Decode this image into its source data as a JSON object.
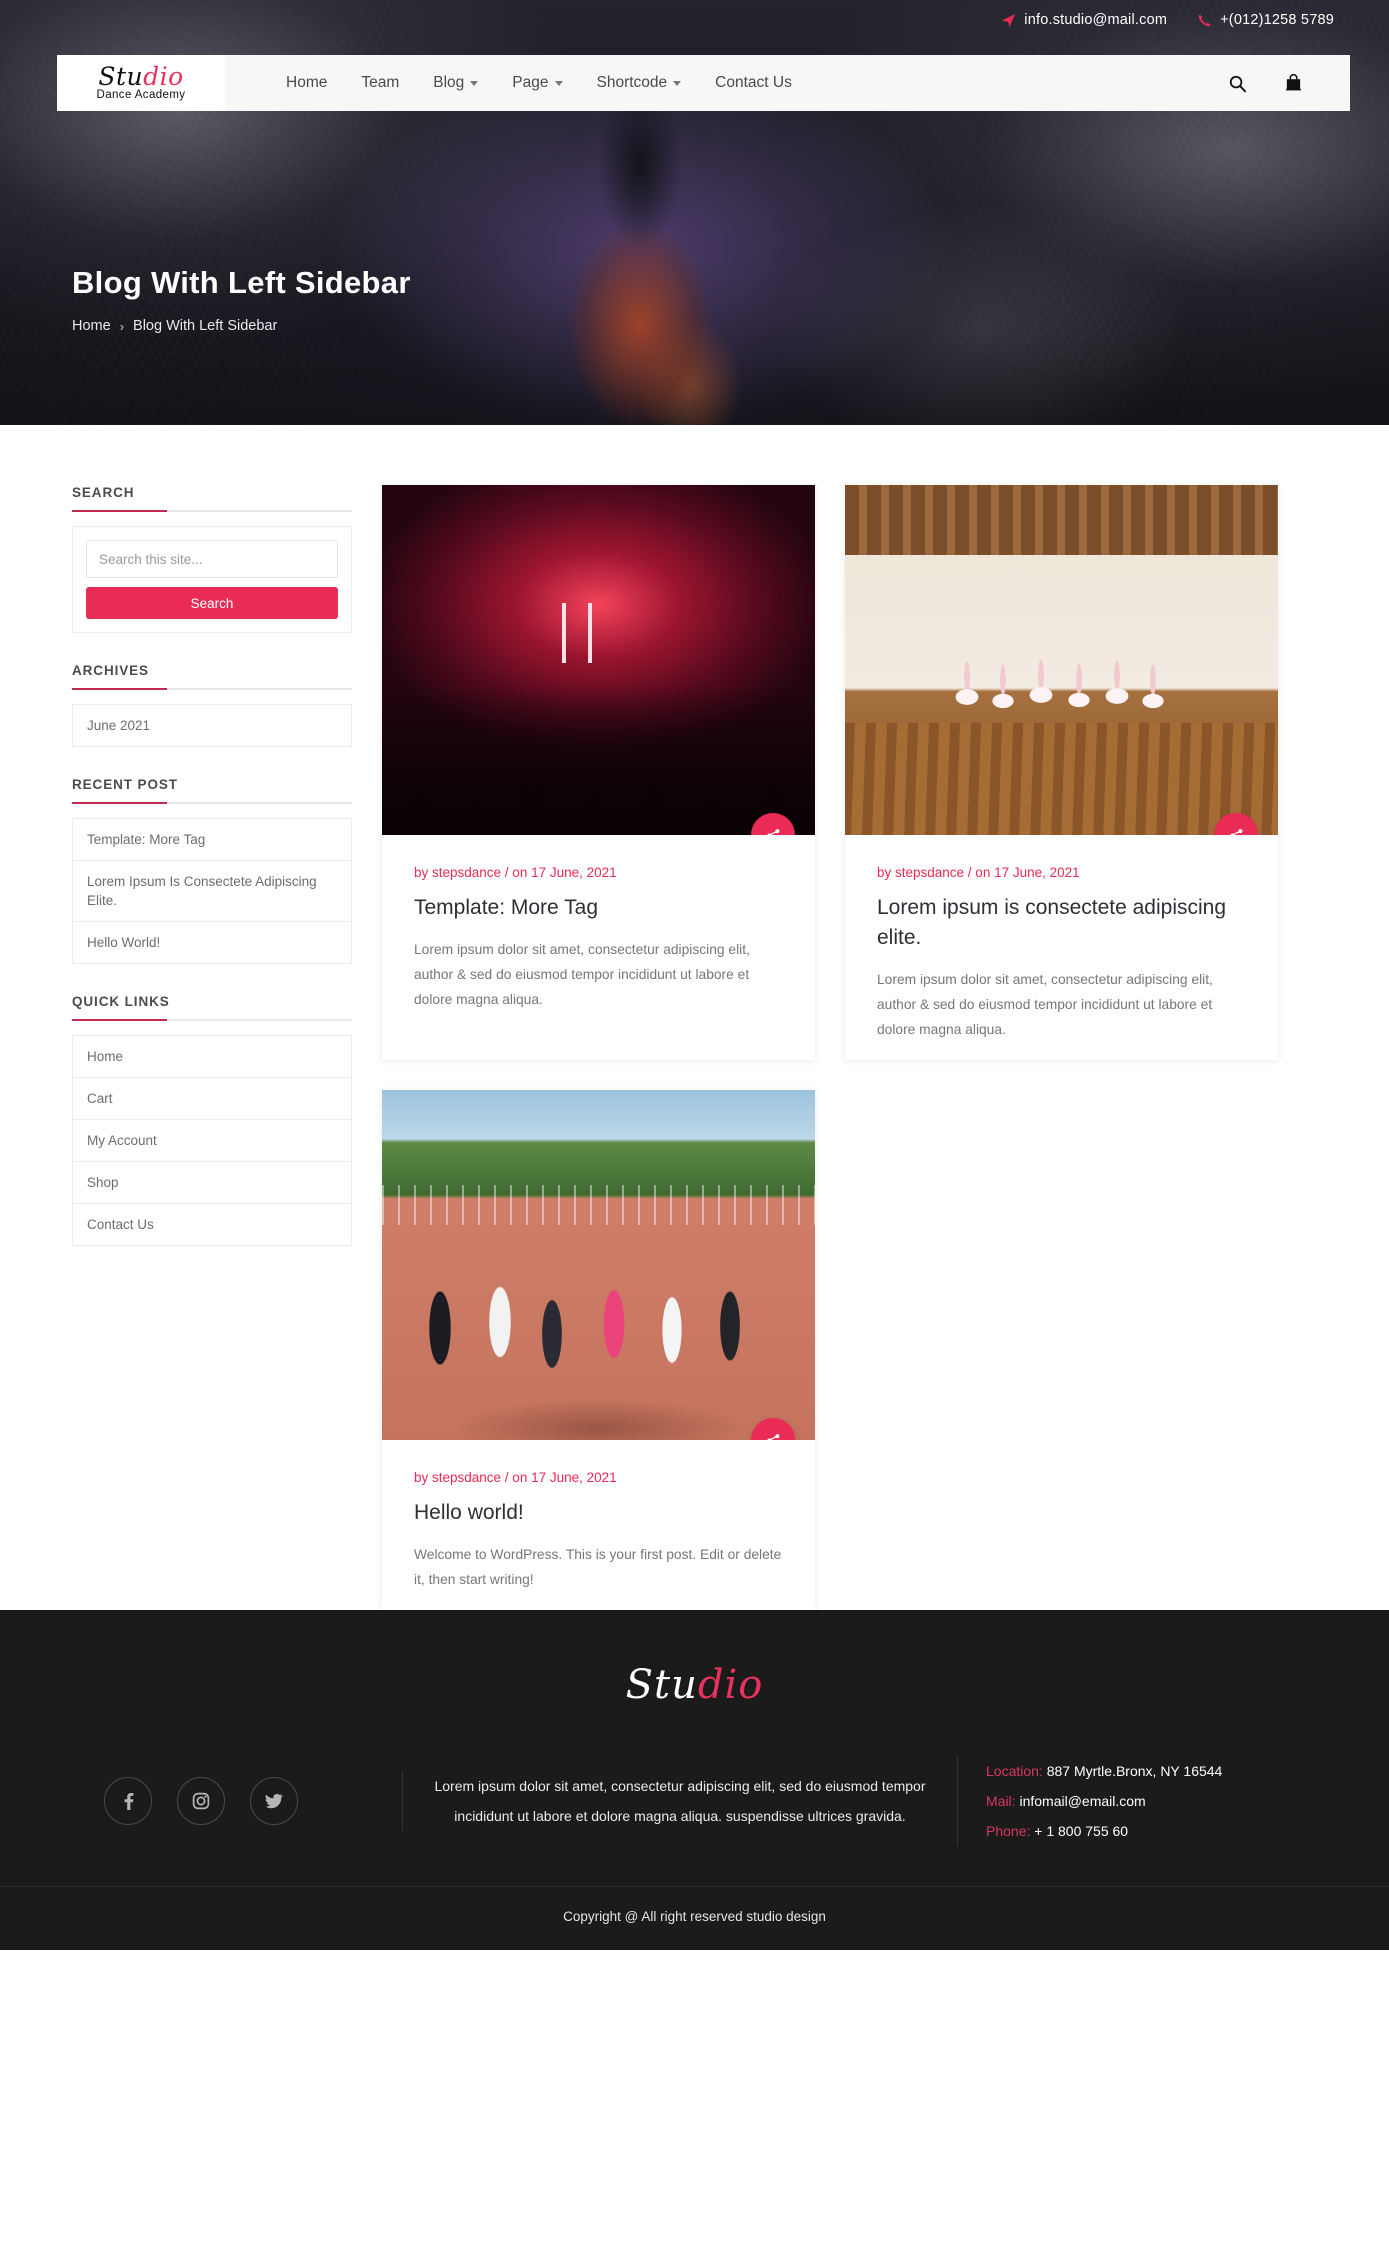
{
  "topbar": {
    "email": "info.studio@mail.com",
    "phone": "+(012)1258 5789",
    "email_icon": "send-icon",
    "phone_icon": "phone-icon"
  },
  "header": {
    "logo_part1": "Stu",
    "logo_part2": "dio",
    "logo_subtitle": "Dance Academy",
    "nav": [
      {
        "label": "Home",
        "has_caret": false
      },
      {
        "label": "Team",
        "has_caret": false
      },
      {
        "label": "Blog",
        "has_caret": true
      },
      {
        "label": "Page",
        "has_caret": true
      },
      {
        "label": "Shortcode",
        "has_caret": true
      },
      {
        "label": "Contact Us",
        "has_caret": false
      }
    ],
    "search_icon": "search-icon",
    "cart_icon": "shopping-bag-icon"
  },
  "hero": {
    "title": "Blog With Left Sidebar",
    "breadcrumb_home": "Home",
    "breadcrumb_sep": "›",
    "breadcrumb_current": "Blog With Left Sidebar"
  },
  "sidebar": {
    "search": {
      "heading": "SEARCH",
      "placeholder": "Search this site...",
      "value": "",
      "button": "Search"
    },
    "archives": {
      "heading": "ARCHIVES",
      "items": [
        "June 2021"
      ]
    },
    "recent_post": {
      "heading": "RECENT POST",
      "items": [
        "Template: More Tag",
        "Lorem Ipsum Is Consectete Adipiscing Elite.",
        "Hello World!"
      ]
    },
    "quick_links": {
      "heading": "QUICK LINKS",
      "items": [
        "Home",
        "Cart",
        "My Account",
        "Shop",
        "Contact Us"
      ]
    }
  },
  "posts": [
    {
      "meta": "by stepsdance / on 17 June, 2021",
      "title": "Template: More Tag",
      "excerpt": "Lorem ipsum dolor sit amet, consectetur adipiscing elit, author & sed do eiusmod tempor incididunt ut labore et dolore magna aliqua.",
      "thumb": "concert-crowd-red-lights-image",
      "share_icon": "share-icon"
    },
    {
      "meta": "by stepsdance / on 17 June, 2021",
      "title": "Lorem ipsum is consectete adipiscing elite.",
      "excerpt": "Lorem ipsum dolor sit amet, consectetur adipiscing elit, author & sed do eiusmod tempor incididunt ut labore et dolore magna aliqua.",
      "thumb": "ballet-dancers-studio-image",
      "share_icon": "share-icon"
    },
    {
      "meta": "by stepsdance / on 17 June, 2021",
      "title": "Hello world!",
      "excerpt": "Welcome to WordPress. This is your first post. Edit or delete it, then start writing!",
      "thumb": "outdoor-dance-class-image",
      "share_icon": "share-icon"
    }
  ],
  "footer": {
    "logo_part1": "Stu",
    "logo_part2": "dio",
    "social": [
      {
        "name": "facebook-icon"
      },
      {
        "name": "instagram-icon"
      },
      {
        "name": "twitter-icon"
      }
    ],
    "about": "Lorem ipsum dolor sit amet, consectetur adipiscing elit, sed do eiusmod tempor incididunt ut labore et dolore magna aliqua. suspendisse ultrices gravida.",
    "contact": {
      "location_label": "Location:",
      "location_value": "887 Myrtle.Bronx, NY 16544",
      "mail_label": "Mail:",
      "mail_value": "infomail@email.com",
      "phone_label": "Phone:",
      "phone_value": "+ 1 800 755 60"
    },
    "copyright": "Copyright @ All right reserved studio design"
  },
  "colors": {
    "accent": "#ea2b55",
    "accent_dark": "#c32b4e",
    "footer_bg": "#1b1b1b",
    "hero_bg": "#1b1b22"
  }
}
